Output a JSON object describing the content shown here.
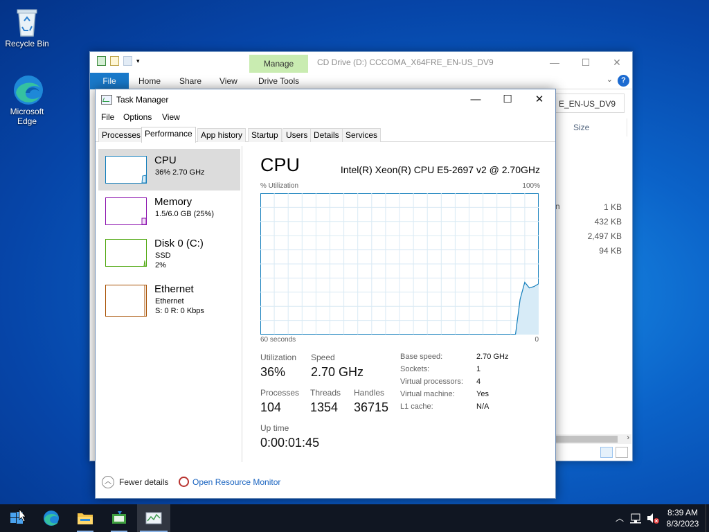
{
  "desktop": {
    "icons": [
      {
        "label": "Recycle Bin",
        "icon": "recycle-bin-icon"
      },
      {
        "label": "Microsoft Edge",
        "icon": "edge-icon"
      }
    ]
  },
  "explorer": {
    "title": "CD Drive (D:) CCCOMA_X64FRE_EN-US_DV9",
    "context_tab": "Manage",
    "ribbon_tabs": [
      "File",
      "Home",
      "Share",
      "View",
      "Drive Tools"
    ],
    "address_fragment": "E_EN-US_DV9",
    "size_header": "Size",
    "name_fragment": "n",
    "sizes": [
      "1 KB",
      "432 KB",
      "2,497 KB",
      "94 KB"
    ],
    "help": "?"
  },
  "taskmgr": {
    "title": "Task Manager",
    "menu": [
      "File",
      "Options",
      "View"
    ],
    "tabs": [
      "Processes",
      "Performance",
      "App history",
      "Startup",
      "Users",
      "Details",
      "Services"
    ],
    "active_tab": "Performance",
    "sidebar": {
      "cpu": {
        "name": "CPU",
        "sub1": "36% 2.70 GHz",
        "color": "#117dbb"
      },
      "memory": {
        "name": "Memory",
        "sub1": "1.5/6.0 GB (25%)",
        "color": "#8b12ae"
      },
      "disk": {
        "name": "Disk 0 (C:)",
        "sub1": "SSD",
        "sub2": "2%",
        "color": "#4da60c"
      },
      "ethernet": {
        "name": "Ethernet",
        "sub1": "Ethernet",
        "sub2": "S: 0 R: 0 Kbps",
        "color": "#a74f01"
      }
    },
    "cpu_panel": {
      "title": "CPU",
      "model": "Intel(R) Xeon(R) CPU E5-2697 v2 @ 2.70GHz",
      "y_label": "% Utilization",
      "y_max": "100%",
      "x_left": "60 seconds",
      "x_right": "0",
      "stats": {
        "utilization_label": "Utilization",
        "utilization": "36%",
        "speed_label": "Speed",
        "speed": "2.70 GHz",
        "processes_label": "Processes",
        "processes": "104",
        "threads_label": "Threads",
        "threads": "1354",
        "handles_label": "Handles",
        "handles": "36715",
        "uptime_label": "Up time",
        "uptime": "0:00:01:45"
      },
      "specs": [
        {
          "k": "Base speed:",
          "v": "2.70 GHz"
        },
        {
          "k": "Sockets:",
          "v": "1"
        },
        {
          "k": "Virtual processors:",
          "v": "4"
        },
        {
          "k": "Virtual machine:",
          "v": "Yes"
        },
        {
          "k": "L1 cache:",
          "v": "N/A"
        }
      ]
    },
    "footer": {
      "fewer": "Fewer details",
      "monitor": "Open Resource Monitor"
    }
  },
  "chart_data": {
    "type": "area",
    "ylim": [
      0,
      100
    ],
    "xlim": [
      60,
      0
    ],
    "x": [
      60,
      55,
      50,
      45,
      40,
      35,
      30,
      25,
      20,
      15,
      10,
      8,
      7,
      6,
      5,
      4,
      3,
      2,
      1,
      0
    ],
    "series": [
      {
        "values": [
          0,
          0,
          0,
          0,
          0,
          0,
          0,
          0,
          0,
          0,
          0,
          0,
          0,
          0,
          0,
          25,
          37,
          33,
          34,
          36
        ]
      }
    ],
    "color": "#117dbb",
    "grid": true
  },
  "taskbar": {
    "apps": [
      "start-icon",
      "edge-icon",
      "file-explorer-icon",
      "setup-icon",
      "task-manager-icon"
    ],
    "time": "8:39 AM",
    "date": "8/3/2023"
  }
}
